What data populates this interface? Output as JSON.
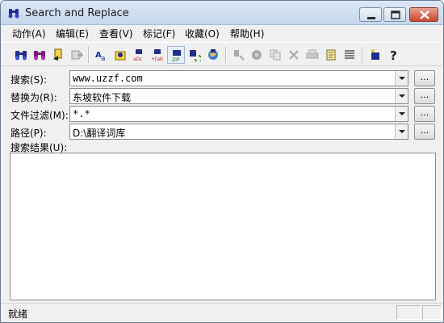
{
  "window": {
    "title": "Search and Replace",
    "title_icon": "binoculars-icon"
  },
  "menu": [
    {
      "label": "动作(A)"
    },
    {
      "label": "编辑(E)"
    },
    {
      "label": "查看(V)"
    },
    {
      "label": "标记(F)"
    },
    {
      "label": "收藏(O)"
    },
    {
      "label": "帮助(H)"
    }
  ],
  "toolbar": {
    "icons": [
      "search-icon",
      "search-all-icon",
      "replace-file-icon",
      "move-icon",
      "find-text-icon",
      "find-folder-icon",
      "replace-abc-icon",
      "replace-ab-icon",
      "zip-search-icon",
      "refresh-search-icon",
      "globe-search-icon",
      "filter-icon",
      "disk-icon",
      "copy-icon",
      "delete-icon",
      "print-icon",
      "script-icon",
      "list-icon",
      "about-icon",
      "help-icon"
    ]
  },
  "fields": {
    "search": {
      "label": "搜索(S):",
      "value": "www.uzzf.com"
    },
    "replace": {
      "label": "替换为(R):",
      "value": "东坡软件下载"
    },
    "filter": {
      "label": "文件过滤(M):",
      "value": "*.*"
    },
    "path": {
      "label": "路径(P):",
      "value": "D:\\翻译词库"
    },
    "browse_label": "..."
  },
  "results": {
    "label": "搜索结果(U):"
  },
  "status": {
    "text": "就绪"
  },
  "colors": {
    "accent": "#0078d7",
    "close_button": "#c8462d",
    "window_bg": "#f0f0f0"
  }
}
